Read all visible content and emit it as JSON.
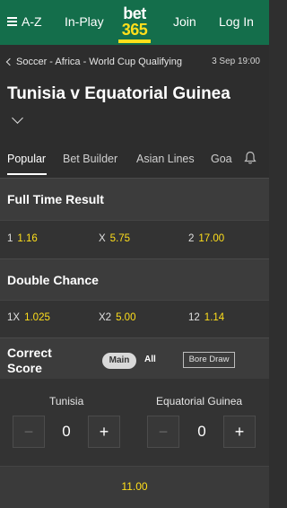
{
  "nav": {
    "az_label": "A-Z",
    "inplay_label": "In-Play",
    "logo_top": "bet",
    "logo_bottom": "365",
    "join_label": "Join",
    "login_label": "Log In"
  },
  "event": {
    "breadcrumb": "Soccer - Africa - World Cup Qualifying",
    "kickoff": "3 Sep 19:00",
    "title": "Tunisia v Equatorial Guinea"
  },
  "tabs": [
    {
      "label": "Popular",
      "active": true
    },
    {
      "label": "Bet Builder",
      "active": false
    },
    {
      "label": "Asian Lines",
      "active": false
    },
    {
      "label": "Goa",
      "active": false
    }
  ],
  "full_time_result": {
    "title": "Full Time Result",
    "selections": [
      {
        "name": "1",
        "odds": "1.16"
      },
      {
        "name": "X",
        "odds": "5.75"
      },
      {
        "name": "2",
        "odds": "17.00"
      }
    ]
  },
  "double_chance": {
    "title": "Double Chance",
    "selections": [
      {
        "name": "1X",
        "odds": "1.025"
      },
      {
        "name": "X2",
        "odds": "5.00"
      },
      {
        "name": "12",
        "odds": "1.14"
      }
    ]
  },
  "correct_score": {
    "title": "Correct Score",
    "main_label": "Main",
    "all_label": "All",
    "bore_draw_label": "Bore Draw",
    "home_team": "Tunisia",
    "away_team": "Equatorial Guinea",
    "home_score": "0",
    "away_score": "0",
    "minus": "−",
    "plus": "+",
    "odds": "11.00"
  },
  "colors": {
    "brand_green": "#146e4b",
    "odds_yellow": "#ffdf1b",
    "background": "#2f2f2f"
  }
}
